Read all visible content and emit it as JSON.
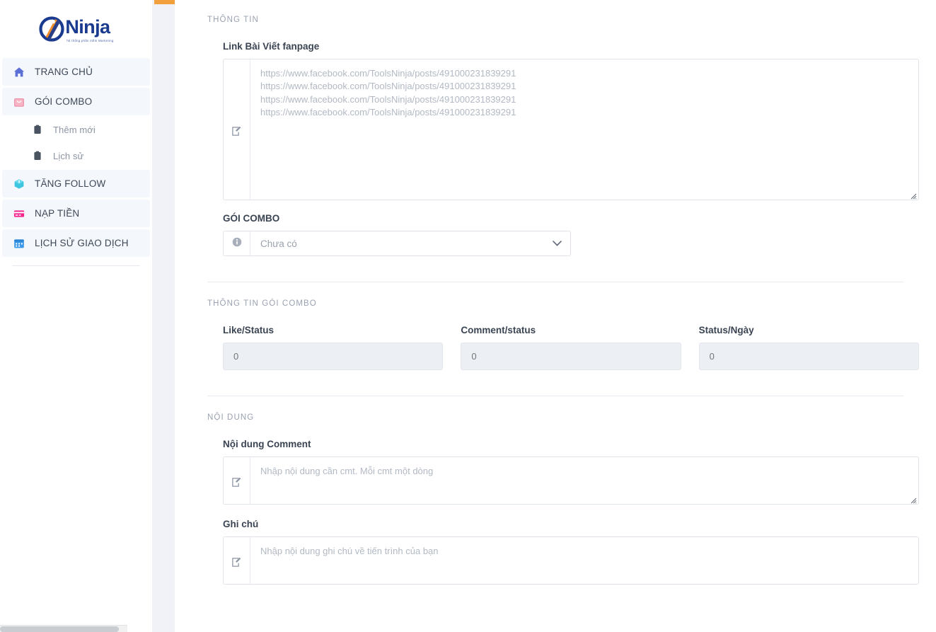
{
  "brand": {
    "name": "Ninja",
    "tagline": "hệ thống phần mềm Marketing",
    "logo_blue": "#1a3a8f",
    "logo_orange": "#f28d2e"
  },
  "sidebar": {
    "items": [
      {
        "label": "TRANG CHỦ",
        "icon": "home-icon",
        "icon_color": "#5b6fd6",
        "level": "top"
      },
      {
        "label": "GÓI COMBO",
        "icon": "shopping-bag-icon",
        "icon_color": "#f08fa8",
        "level": "top"
      },
      {
        "label": "Thêm mới",
        "icon": "clipboard-icon",
        "icon_color": "#4a5361",
        "level": "sub"
      },
      {
        "label": "Lịch sử",
        "icon": "clipboard-icon",
        "icon_color": "#4a5361",
        "level": "sub"
      },
      {
        "label": "TĂNG FOLLOW",
        "icon": "box-icon",
        "icon_color": "#3ec6e0",
        "level": "top"
      },
      {
        "label": "NẠP TIỀN",
        "icon": "credit-card-icon",
        "icon_color": "#f5278f",
        "level": "top"
      },
      {
        "label": "LỊCH SỬ GIAO DỊCH",
        "icon": "calendar-icon",
        "icon_color": "#3c9ae8",
        "level": "top"
      }
    ]
  },
  "main": {
    "sections": {
      "info": {
        "title": "THÔNG TIN",
        "link_field": {
          "label": "Link Bài Viết fanpage",
          "value": "",
          "placeholder": "https://www.facebook.com/ToolsNinja/posts/491000231839291\nhttps://www.facebook.com/ToolsNinja/posts/491000231839291\nhttps://www.facebook.com/ToolsNinja/posts/491000231839291\nhttps://www.facebook.com/ToolsNinja/posts/491000231839291",
          "addon_icon": "edit-square-icon"
        },
        "combo_select": {
          "label": "GÓI COMBO",
          "selected": "Chưa có",
          "options": [
            "Chưa có"
          ],
          "addon_icon": "info-circle-icon",
          "chevron_icon": "chevron-down-icon"
        }
      },
      "combo_info": {
        "title": "THÔNG TIN GÓI COMBO",
        "fields": [
          {
            "label": "Like/Status",
            "value": "",
            "placeholder": "0",
            "disabled": true
          },
          {
            "label": "Comment/status",
            "value": "",
            "placeholder": "0",
            "disabled": true
          },
          {
            "label": "Status/Ngày",
            "value": "",
            "placeholder": "0",
            "disabled": true
          }
        ]
      },
      "content": {
        "title": "NỘI DUNG",
        "comment_field": {
          "label": "Nội dung Comment",
          "value": "",
          "placeholder": "Nhập nội dung cần cmt. Mỗi cmt một dòng",
          "addon_icon": "edit-square-icon"
        },
        "note_field": {
          "label": "Ghi chú",
          "value": "",
          "placeholder": "Nhập nội dung ghi chú về tiến trình của bạn",
          "addon_icon": "edit-square-icon"
        }
      }
    }
  }
}
